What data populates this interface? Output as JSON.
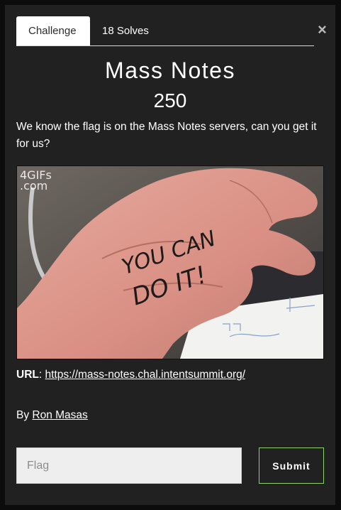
{
  "modal": {
    "close_label": "×",
    "tabs": [
      {
        "label": "Challenge",
        "active": true
      },
      {
        "label": "18 Solves",
        "active": false
      }
    ],
    "challenge": {
      "name": "Mass Notes",
      "points": "250",
      "description": "We know the flag is on the Mass Notes servers, can you get it for us?",
      "image_watermark": "4GIFs\n.com",
      "image_text": "YOU CAN DO IT!",
      "url_label": "URL",
      "url_sep": ":",
      "url": "https://mass-notes.chal.intentsummit.org/",
      "by_label": "By",
      "author": "Ron Masas"
    },
    "form": {
      "flag_placeholder": "Flag",
      "flag_value": "",
      "submit_label": "Submit"
    }
  },
  "colors": {
    "backdrop": "#0c0c0c",
    "modal_bg": "#212121",
    "submit_border": "#8ed16a",
    "text": "#ffffff"
  },
  "icons": {
    "close": "close-icon"
  }
}
